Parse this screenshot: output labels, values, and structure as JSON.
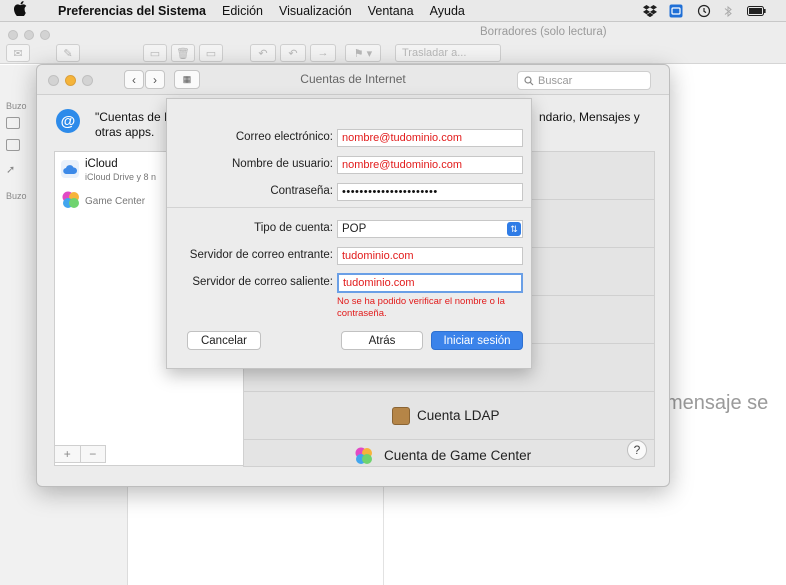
{
  "menubar": {
    "apple_icon": "apple-icon",
    "app_name": "Preferencias del Sistema",
    "menus": [
      "Edición",
      "Visualización",
      "Ventana",
      "Ayuda"
    ]
  },
  "mail": {
    "title": "Borradores (solo lectura)",
    "toolbar": {
      "move_to": "Trasladar a..."
    },
    "sidebar": {
      "mailboxes_1": "Buzo",
      "mailboxes_2": "Buzo"
    },
    "no_message": "mensaje se"
  },
  "internet_accounts": {
    "title": "Cuentas de Internet",
    "search_placeholder": "Buscar",
    "header_text": "\"Cuentas de I otras apps.",
    "header_right": "ndario, Mensajes y",
    "accounts": [
      {
        "name": "iCloud",
        "detail": "iCloud Drive y 8 n"
      },
      {
        "name": "",
        "detail": "Game Center"
      }
    ],
    "list_add": "+",
    "list_remove": "−",
    "providers": {
      "ldap": "Cuenta LDAP",
      "game_center": "Cuenta de Game Center"
    },
    "help": "?"
  },
  "sheet": {
    "email_label": "Correo electrónico:",
    "email_value": "nombre@tudominio.com",
    "username_label": "Nombre de usuario:",
    "username_value": "nombre@tudominio.com",
    "password_label": "Contraseña:",
    "password_value": "••••••••••••••••••••••",
    "account_type_label": "Tipo de cuenta:",
    "account_type_value": "POP",
    "incoming_label": "Servidor de correo entrante:",
    "incoming_value": "tudominio.com",
    "outgoing_label": "Servidor de correo saliente:",
    "outgoing_value": "tudominio.com",
    "error": "No se ha podido verificar el nombre o la contraseña.",
    "cancel": "Cancelar",
    "back": "Atrás",
    "sign_in": "Iniciar sesión"
  },
  "colors": {
    "accent": "#3b83ea",
    "error": "#e21b1b"
  }
}
